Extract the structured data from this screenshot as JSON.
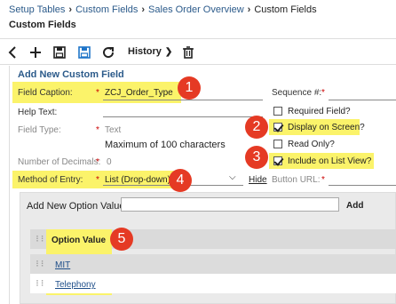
{
  "breadcrumb": {
    "items": [
      "Setup Tables",
      "Custom Fields",
      "Sales Order Overview"
    ],
    "current": "Custom Fields"
  },
  "page_title": "Custom Fields",
  "toolbar": {
    "history_label": "History"
  },
  "form": {
    "section_title": "Add New Custom Field",
    "caption_label": "Field Caption:",
    "caption_value": "ZCJ_Order_Type",
    "help_label": "Help Text:",
    "type_label": "Field Type:",
    "type_value": "Text",
    "max_note": "Maximum of 100 characters",
    "decimals_label": "Number of Decimals:",
    "decimals_value": "0",
    "method_label": "Method of Entry:",
    "method_value": "List (Drop-down)",
    "hide_link": "Hide",
    "sequence_label": "Sequence #:",
    "required_label": "Required Field?",
    "display_label": "Display on Screen?",
    "readonly_label": "Read Only?",
    "listview_label": "Include on List View?",
    "button_url_label": "Button URL:",
    "asterisk": "*"
  },
  "options": {
    "add_label": "Add New Option Value :",
    "add_button": "Add",
    "column_header": "Option Value",
    "rows": [
      "MIT",
      "Telephony"
    ]
  },
  "callouts": [
    "1",
    "2",
    "3",
    "4",
    "5"
  ]
}
